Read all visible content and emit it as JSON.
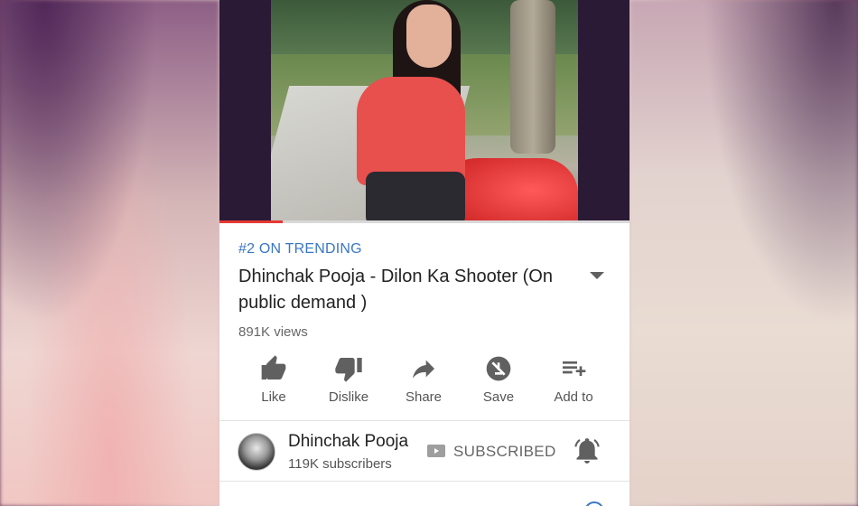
{
  "video": {
    "progress_fraction": 0.155
  },
  "trending_badge": "#2 ON TRENDING",
  "title": "Dhinchak Pooja - Dilon Ka Shooter (On public demand )",
  "views": "891K views",
  "actions": [
    {
      "label": "Like",
      "icon": "thumbs-up-icon"
    },
    {
      "label": "Dislike",
      "icon": "thumbs-down-icon"
    },
    {
      "label": "Share",
      "icon": "share-arrow-icon"
    },
    {
      "label": "Save",
      "icon": "save-offline-icon"
    },
    {
      "label": "Add to",
      "icon": "playlist-add-icon"
    }
  ],
  "channel": {
    "name": "Dhinchak Pooja",
    "subscribers": "119K subscribers",
    "subscribe_status": "SUBSCRIBED"
  },
  "colors": {
    "accent_blue": "#3a77c4",
    "progress_red": "#e53935",
    "icon_gray": "#606060"
  }
}
